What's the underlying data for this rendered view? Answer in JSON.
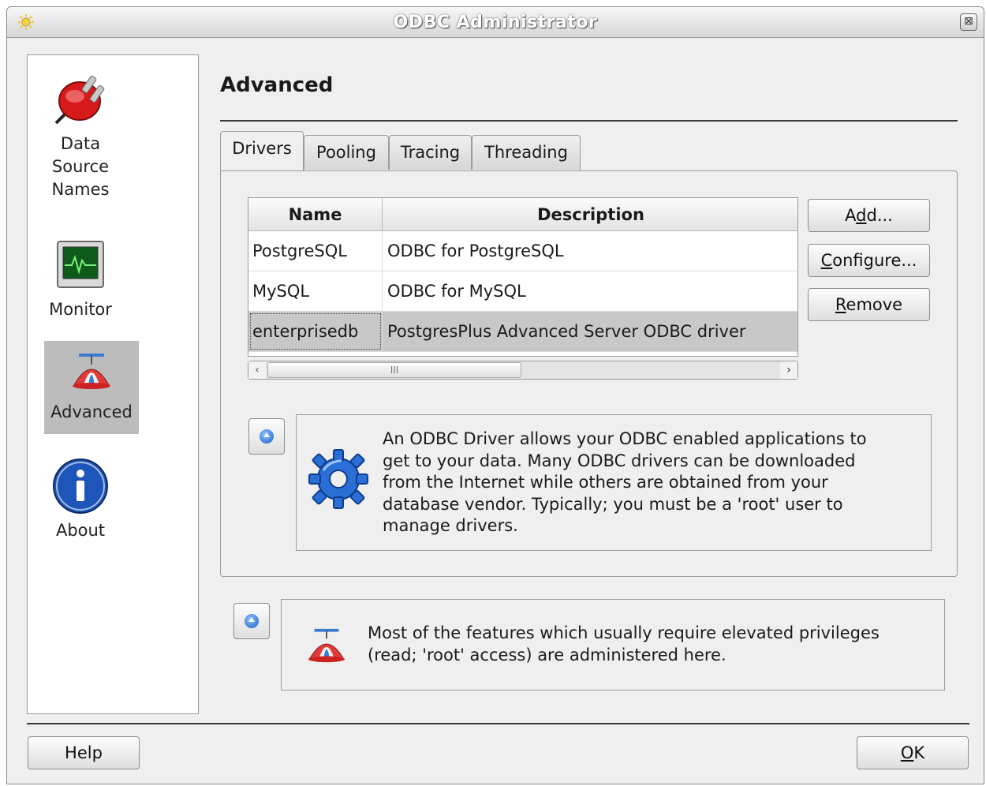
{
  "window": {
    "title": "ODBC Administrator",
    "close_glyph": "⊠"
  },
  "sidebar": {
    "items": [
      {
        "label_lines": [
          "Data",
          "Source",
          "Names"
        ],
        "icon": "plug-icon"
      },
      {
        "label_lines": [
          "Monitor"
        ],
        "icon": "monitor-icon"
      },
      {
        "label_lines": [
          "Advanced"
        ],
        "icon": "propeller-hat-icon",
        "active": true
      },
      {
        "label_lines": [
          "About"
        ],
        "icon": "info-icon"
      }
    ]
  },
  "main": {
    "heading": "Advanced",
    "tabs": [
      "Drivers",
      "Pooling",
      "Tracing",
      "Threading"
    ],
    "active_tab": "Drivers",
    "table": {
      "headers": [
        "Name",
        "Description"
      ],
      "rows": [
        {
          "name": "PostgreSQL",
          "description": "ODBC for PostgreSQL"
        },
        {
          "name": "MySQL",
          "description": "ODBC for MySQL"
        },
        {
          "name": "enterprisedb",
          "description": "PostgresPlus Advanced Server ODBC driver",
          "selected": true
        }
      ],
      "scroll_grip": "III"
    },
    "buttons": {
      "add": {
        "pre": "A",
        "mnemonic": "d",
        "post": "d..."
      },
      "configure": {
        "pre": "",
        "mnemonic": "C",
        "post": "onfigure..."
      },
      "remove": {
        "pre": "",
        "mnemonic": "R",
        "post": "emove"
      }
    },
    "drivers_info": {
      "icon": "gear-icon",
      "text_lines": [
        "An ODBC Driver allows your ODBC enabled applications to",
        "get to your data. Many ODBC drivers can be downloaded",
        "from the Internet while others are obtained from your",
        "database vendor. Typically; you must be a 'root' user to",
        "manage drivers."
      ]
    },
    "advanced_info": {
      "icon": "propeller-hat-icon",
      "text_lines": [
        "Most of the features which usually require elevated privileges",
        "(read; 'root' access) are administered here."
      ]
    }
  },
  "footer": {
    "help_label": "Help",
    "ok": {
      "pre": "",
      "mnemonic": "O",
      "post": "K"
    }
  },
  "colors": {
    "selection": "#c8c8c8",
    "sidebar_active": "#bcbcbc",
    "info_blue": "#1a5fc8"
  }
}
